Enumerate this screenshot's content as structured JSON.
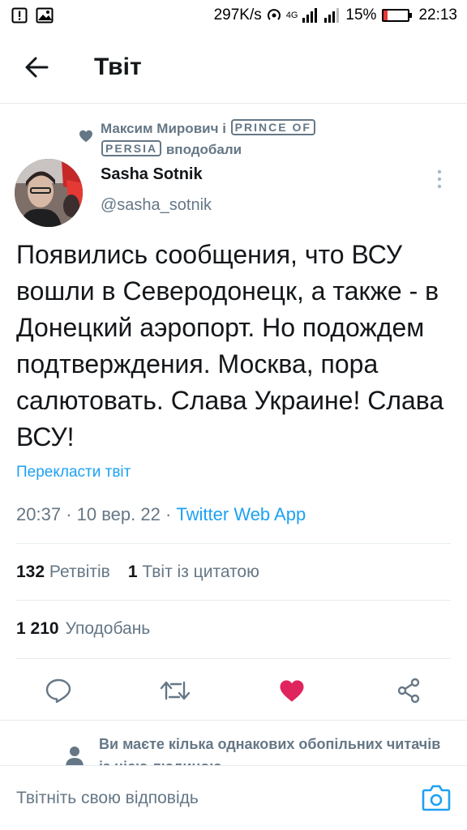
{
  "status_bar": {
    "network_speed": "297K/s",
    "network_type": "4G",
    "battery_percent": "15%",
    "battery_level": 0.15,
    "time": "22:13"
  },
  "header": {
    "title": "Твіт",
    "back_icon": "arrow-left-icon"
  },
  "social_context": {
    "user1": "Максим Мирович",
    "connector": "і",
    "user2_part1": "PRINCE OF",
    "user2_part2": "PERSIA",
    "action": "вподобали"
  },
  "author": {
    "name": "Sasha Sotnik",
    "handle": "@sasha_sotnik"
  },
  "tweet": {
    "text": "Появились сообщения, что ВСУ вошли в Северодонецк, а также - в Донецкий аэропорт. Но подождем подтверждения. Москва, пора салютовать. Слава Украине! Слава ВСУ!",
    "translate_label": "Перекласти твіт",
    "time": "20:37",
    "date": "10 вер. 22",
    "source": "Twitter Web App",
    "separator": "·"
  },
  "stats": {
    "retweets_count": "132",
    "retweets_label": "Ретвітів",
    "quotes_count": "1",
    "quotes_label": "Твіт із цитатою",
    "likes_count": "1 210",
    "likes_label": "Уподобань"
  },
  "actions": {
    "reply_icon": "reply-icon",
    "retweet_icon": "retweet-icon",
    "like_icon": "heart-icon",
    "share_icon": "share-icon",
    "like_color": "#e0245e"
  },
  "follow_hint": {
    "text": "Ви маєте кілька однакових обопільних читачів із цією людиною"
  },
  "reply_bar": {
    "placeholder": "Твітніть свою відповідь",
    "camera_icon": "camera-icon"
  },
  "colors": {
    "accent": "#1da1f2",
    "secondary_text": "#657786",
    "primary_text": "#14171a"
  }
}
